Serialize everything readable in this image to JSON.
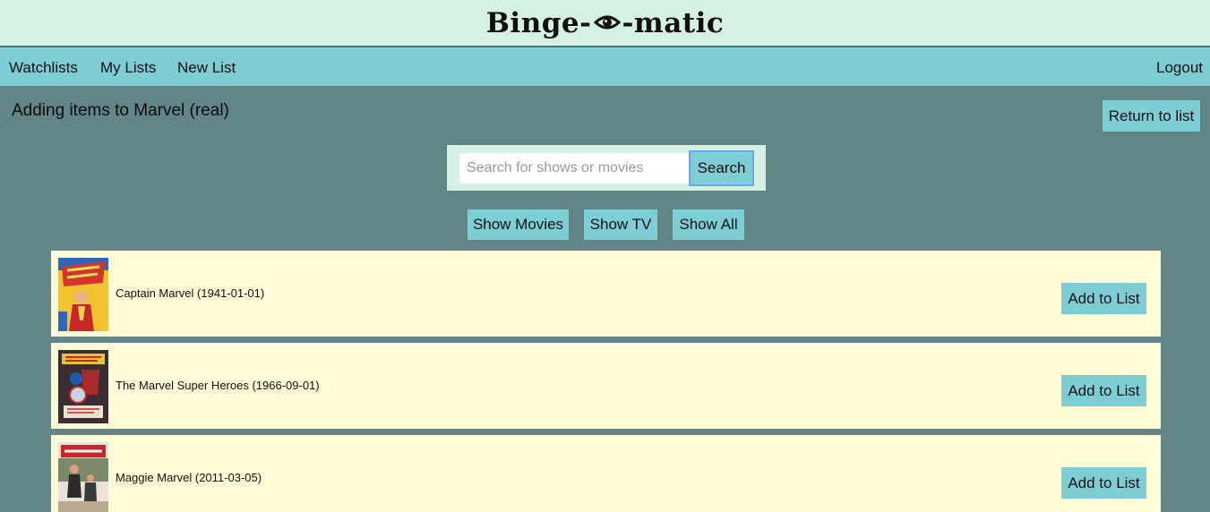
{
  "app": {
    "logo_left": "Binge-",
    "logo_right": "-matic"
  },
  "nav": {
    "watchlists": "Watchlists",
    "my_lists": "My Lists",
    "new_list": "New List",
    "logout": "Logout"
  },
  "page": {
    "heading": "Adding items to Marvel (real)",
    "return_label": "Return to list"
  },
  "search": {
    "placeholder": "Search for shows or movies",
    "value": "",
    "button_label": "Search"
  },
  "filters": {
    "movies": "Show Movies",
    "tv": "Show TV",
    "all": "Show All"
  },
  "results": [
    {
      "title": "Captain Marvel (1941-01-01)",
      "add_label": "Add to List"
    },
    {
      "title": "The Marvel Super Heroes (1966-09-01)",
      "add_label": "Add to List"
    },
    {
      "title": "Maggie Marvel (2011-03-05)",
      "add_label": "Add to List"
    }
  ],
  "colors": {
    "page_bg": "#628686",
    "header_bg": "#d5f1e4",
    "nav_bg": "#7dcdd4",
    "button_bg": "#7dcdd4",
    "card_bg": "#fffbd6"
  }
}
